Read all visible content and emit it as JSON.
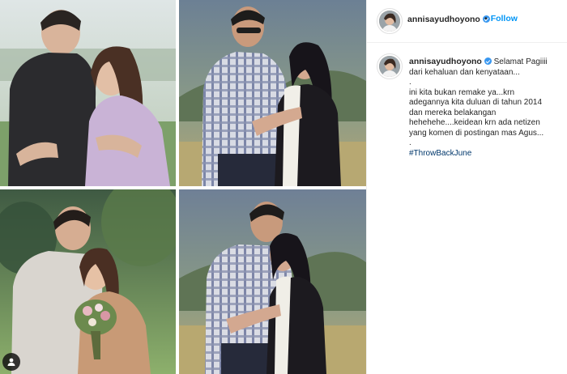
{
  "post": {
    "username": "annisayudhoyono",
    "follow_label": "Follow",
    "separator": "•",
    "caption_first": "Selamat Pagiiii",
    "caption_lines": [
      "dari kehaluan dan kenyataan...",
      ".",
      "ini kita bukan remake ya...krn",
      "adegannya kita duluan di tahun 2014",
      "dan mereka belakangan",
      "hehehehe....keidean krn ada netizen",
      "yang komen di postingan mas Agus...",
      "."
    ],
    "hashtag": "#ThrowBackJune"
  },
  "icons": {
    "verified": "verified-badge-icon",
    "tag": "user-tag-icon"
  },
  "colors": {
    "link": "#0095f6",
    "verified": "#3897f0",
    "hashtag": "#00376b"
  }
}
